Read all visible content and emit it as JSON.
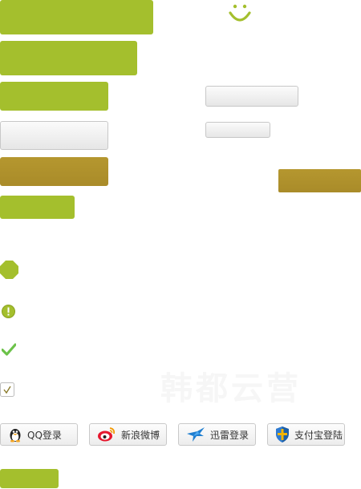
{
  "watermark_text": "韩都云营",
  "login_buttons": [
    {
      "label": "QQ登录",
      "icon": "qq-penguin-icon"
    },
    {
      "label": "新浪微博",
      "icon": "weibo-icon"
    },
    {
      "label": "迅雷登录",
      "icon": "xunlei-bird-icon"
    },
    {
      "label": "支付宝登陆",
      "icon": "alipay-shield-icon"
    }
  ],
  "colors": {
    "accent_green": "#a4bf2d",
    "accent_gold": "#ae902b",
    "neutral_gray": "#e9e9e9"
  }
}
